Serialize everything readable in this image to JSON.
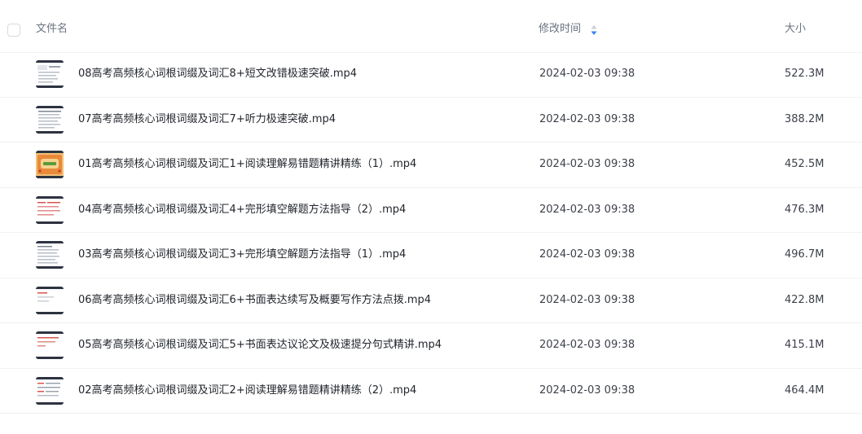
{
  "header": {
    "name_label": "文件名",
    "time_label": "修改时间",
    "size_label": "大小",
    "sort_icon": "sort-desc-icon",
    "sort_color": "#3b82f6"
  },
  "files": [
    {
      "name": "08高考高频核心词根词缀及词汇8+短文改错极速突破.mp4",
      "modified": "2024-02-03 09:38",
      "size": "522.3M",
      "thumb": "video-slide-thumbnail"
    },
    {
      "name": "07高考高频核心词根词缀及词汇7+听力极速突破.mp4",
      "modified": "2024-02-03 09:38",
      "size": "388.2M",
      "thumb": "video-slide-thumbnail"
    },
    {
      "name": "01高考高频核心词根词缀及词汇1+阅读理解易错题精讲精练（1）.mp4",
      "modified": "2024-02-03 09:38",
      "size": "452.5M",
      "thumb": "video-slide-thumbnail-orange"
    },
    {
      "name": "04高考高频核心词根词缀及词汇4+完形填空解题方法指导（2）.mp4",
      "modified": "2024-02-03 09:38",
      "size": "476.3M",
      "thumb": "video-slide-thumbnail"
    },
    {
      "name": "03高考高频核心词根词缀及词汇3+完形填空解题方法指导（1）.mp4",
      "modified": "2024-02-03 09:38",
      "size": "496.7M",
      "thumb": "video-slide-thumbnail"
    },
    {
      "name": "06高考高频核心词根词缀及词汇6+书面表达续写及概要写作方法点拨.mp4",
      "modified": "2024-02-03 09:38",
      "size": "422.8M",
      "thumb": "video-slide-thumbnail"
    },
    {
      "name": "05高考高频核心词根词缀及词汇5+书面表达议论文及极速提分句式精讲.mp4",
      "modified": "2024-02-03 09:38",
      "size": "415.1M",
      "thumb": "video-slide-thumbnail"
    },
    {
      "name": "02高考高频核心词根词缀及词汇2+阅读理解易错题精讲精练（2）.mp4",
      "modified": "2024-02-03 09:38",
      "size": "464.4M",
      "thumb": "video-slide-thumbnail"
    }
  ]
}
